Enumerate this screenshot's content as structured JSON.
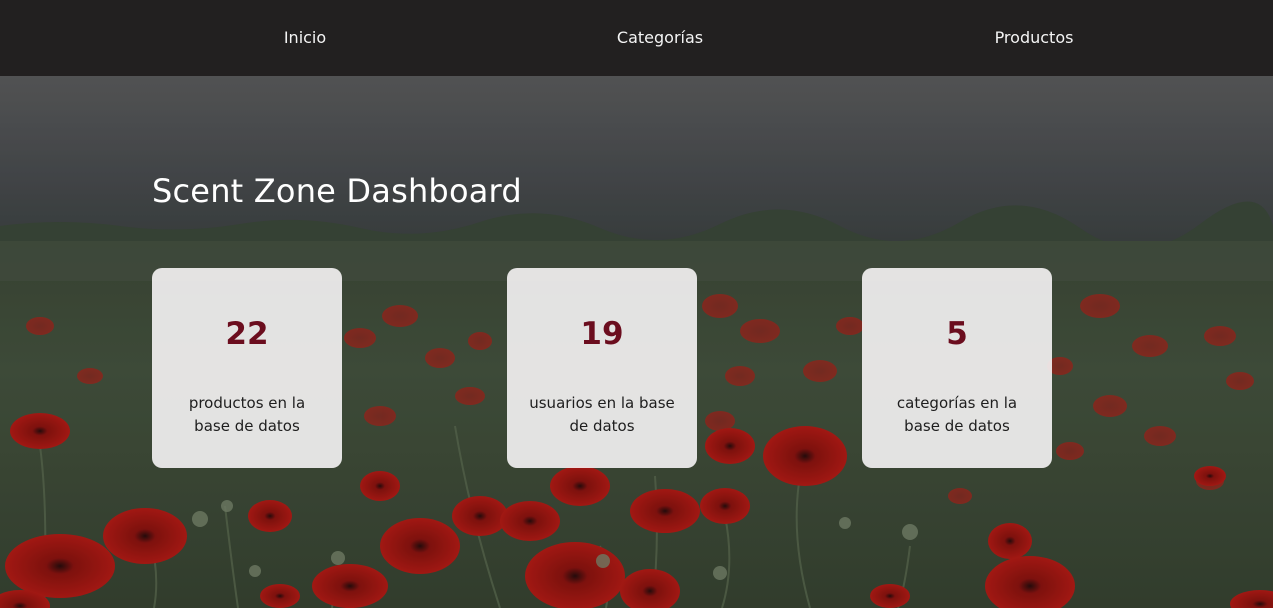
{
  "nav": {
    "items": [
      {
        "label": "Inicio"
      },
      {
        "label": "Categorías"
      },
      {
        "label": "Productos"
      }
    ]
  },
  "dashboard": {
    "title": "Scent Zone Dashboard",
    "cards": [
      {
        "value": "22",
        "label": "productos en la base de datos"
      },
      {
        "value": "19",
        "label": "usuarios en la base de datos"
      },
      {
        "value": "5",
        "label": "categorías en la base de datos"
      }
    ]
  },
  "colors": {
    "navbar": "#222020",
    "nav_text": "#f4f4f4",
    "card_value": "#6b0d1e",
    "card_background": "#f6f4f5",
    "title": "#ffffff"
  }
}
